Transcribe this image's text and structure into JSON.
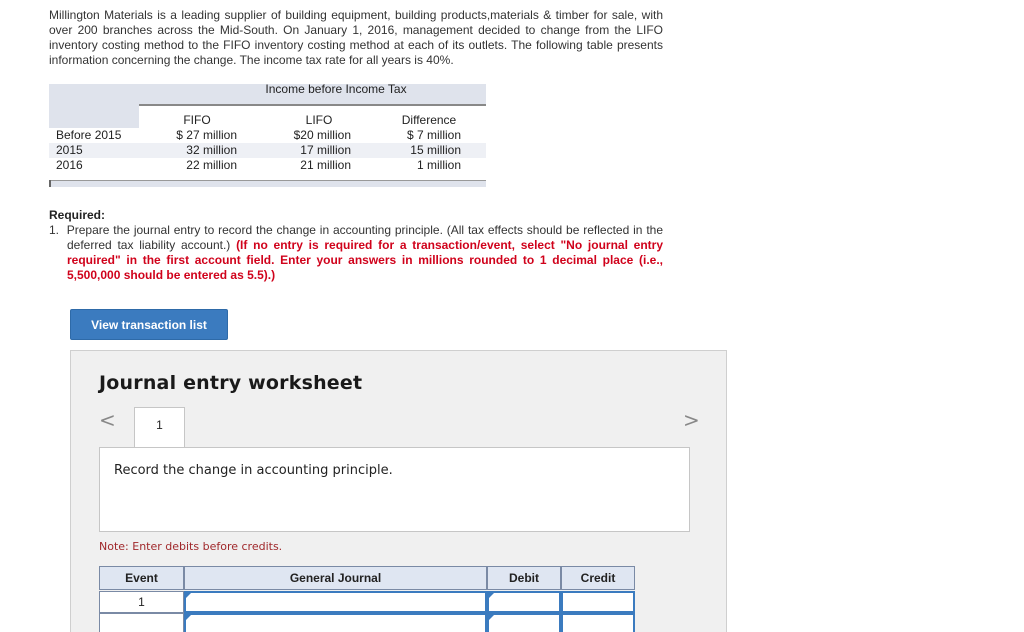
{
  "intro": "Millington Materials is a leading supplier of building equipment, building products,materials & timber for sale, with over 200 branches across the Mid-South. On January 1, 2016, management decided to change from the LIFO inventory costing method to the FIFO inventory costing method at each of its outlets. The following table presents information concerning the change. The income tax rate for all years is 40%.",
  "income_table": {
    "header": "Income before Income Tax",
    "columns": [
      "FIFO",
      "LIFO",
      "Difference"
    ],
    "rows": [
      {
        "label": "Before 2015",
        "fifo": "$ 27 million",
        "lifo": "$20 million",
        "diff": "$  7 million"
      },
      {
        "label": "2015",
        "fifo": "32 million",
        "lifo": "17 million",
        "diff": "15 million"
      },
      {
        "label": "2016",
        "fifo": "22 million",
        "lifo": "21 million",
        "diff": "1 million"
      }
    ]
  },
  "required": {
    "title": "Required:",
    "item_number": "1.",
    "item_text": "Prepare the journal entry to record the change in accounting principle. (All tax effects should be reflected in the deferred tax liability account.)",
    "item_red": "(If no entry is required for a transaction/event, select \"No journal entry required\" in the first account field. Enter your answers in millions rounded to 1 decimal place (i.e., 5,500,000 should be entered as 5.5).)"
  },
  "view_button": "View transaction list",
  "worksheet": {
    "title": "Journal entry worksheet",
    "nav_prev": "<",
    "nav_next": ">",
    "tab": "1",
    "prompt": "Record the change in accounting principle.",
    "note": "Note: Enter debits before credits.",
    "table": {
      "headers": [
        "Event",
        "General Journal",
        "Debit",
        "Credit"
      ],
      "rows": [
        {
          "event": "1"
        },
        {
          "event": ""
        }
      ]
    }
  }
}
